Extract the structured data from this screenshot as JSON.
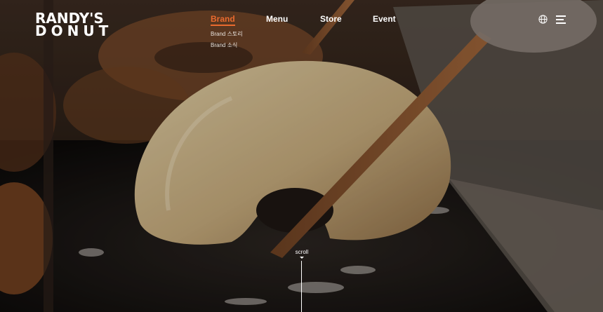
{
  "logo": {
    "line1": "RANDY'S",
    "line2": "DONUT"
  },
  "nav": {
    "items": [
      {
        "label": "Brand",
        "active": true
      },
      {
        "label": "Menu",
        "active": false
      },
      {
        "label": "Store",
        "active": false
      },
      {
        "label": "Event",
        "active": false
      }
    ],
    "brand_submenu": [
      "Brand 스토리",
      "Brand 소식"
    ]
  },
  "icons": {
    "language": "globe-icon",
    "menu": "hamburger-icon"
  },
  "scroll": {
    "label": "scroll"
  },
  "colors": {
    "accent": "#ea6a2e",
    "text": "#ffffff"
  }
}
